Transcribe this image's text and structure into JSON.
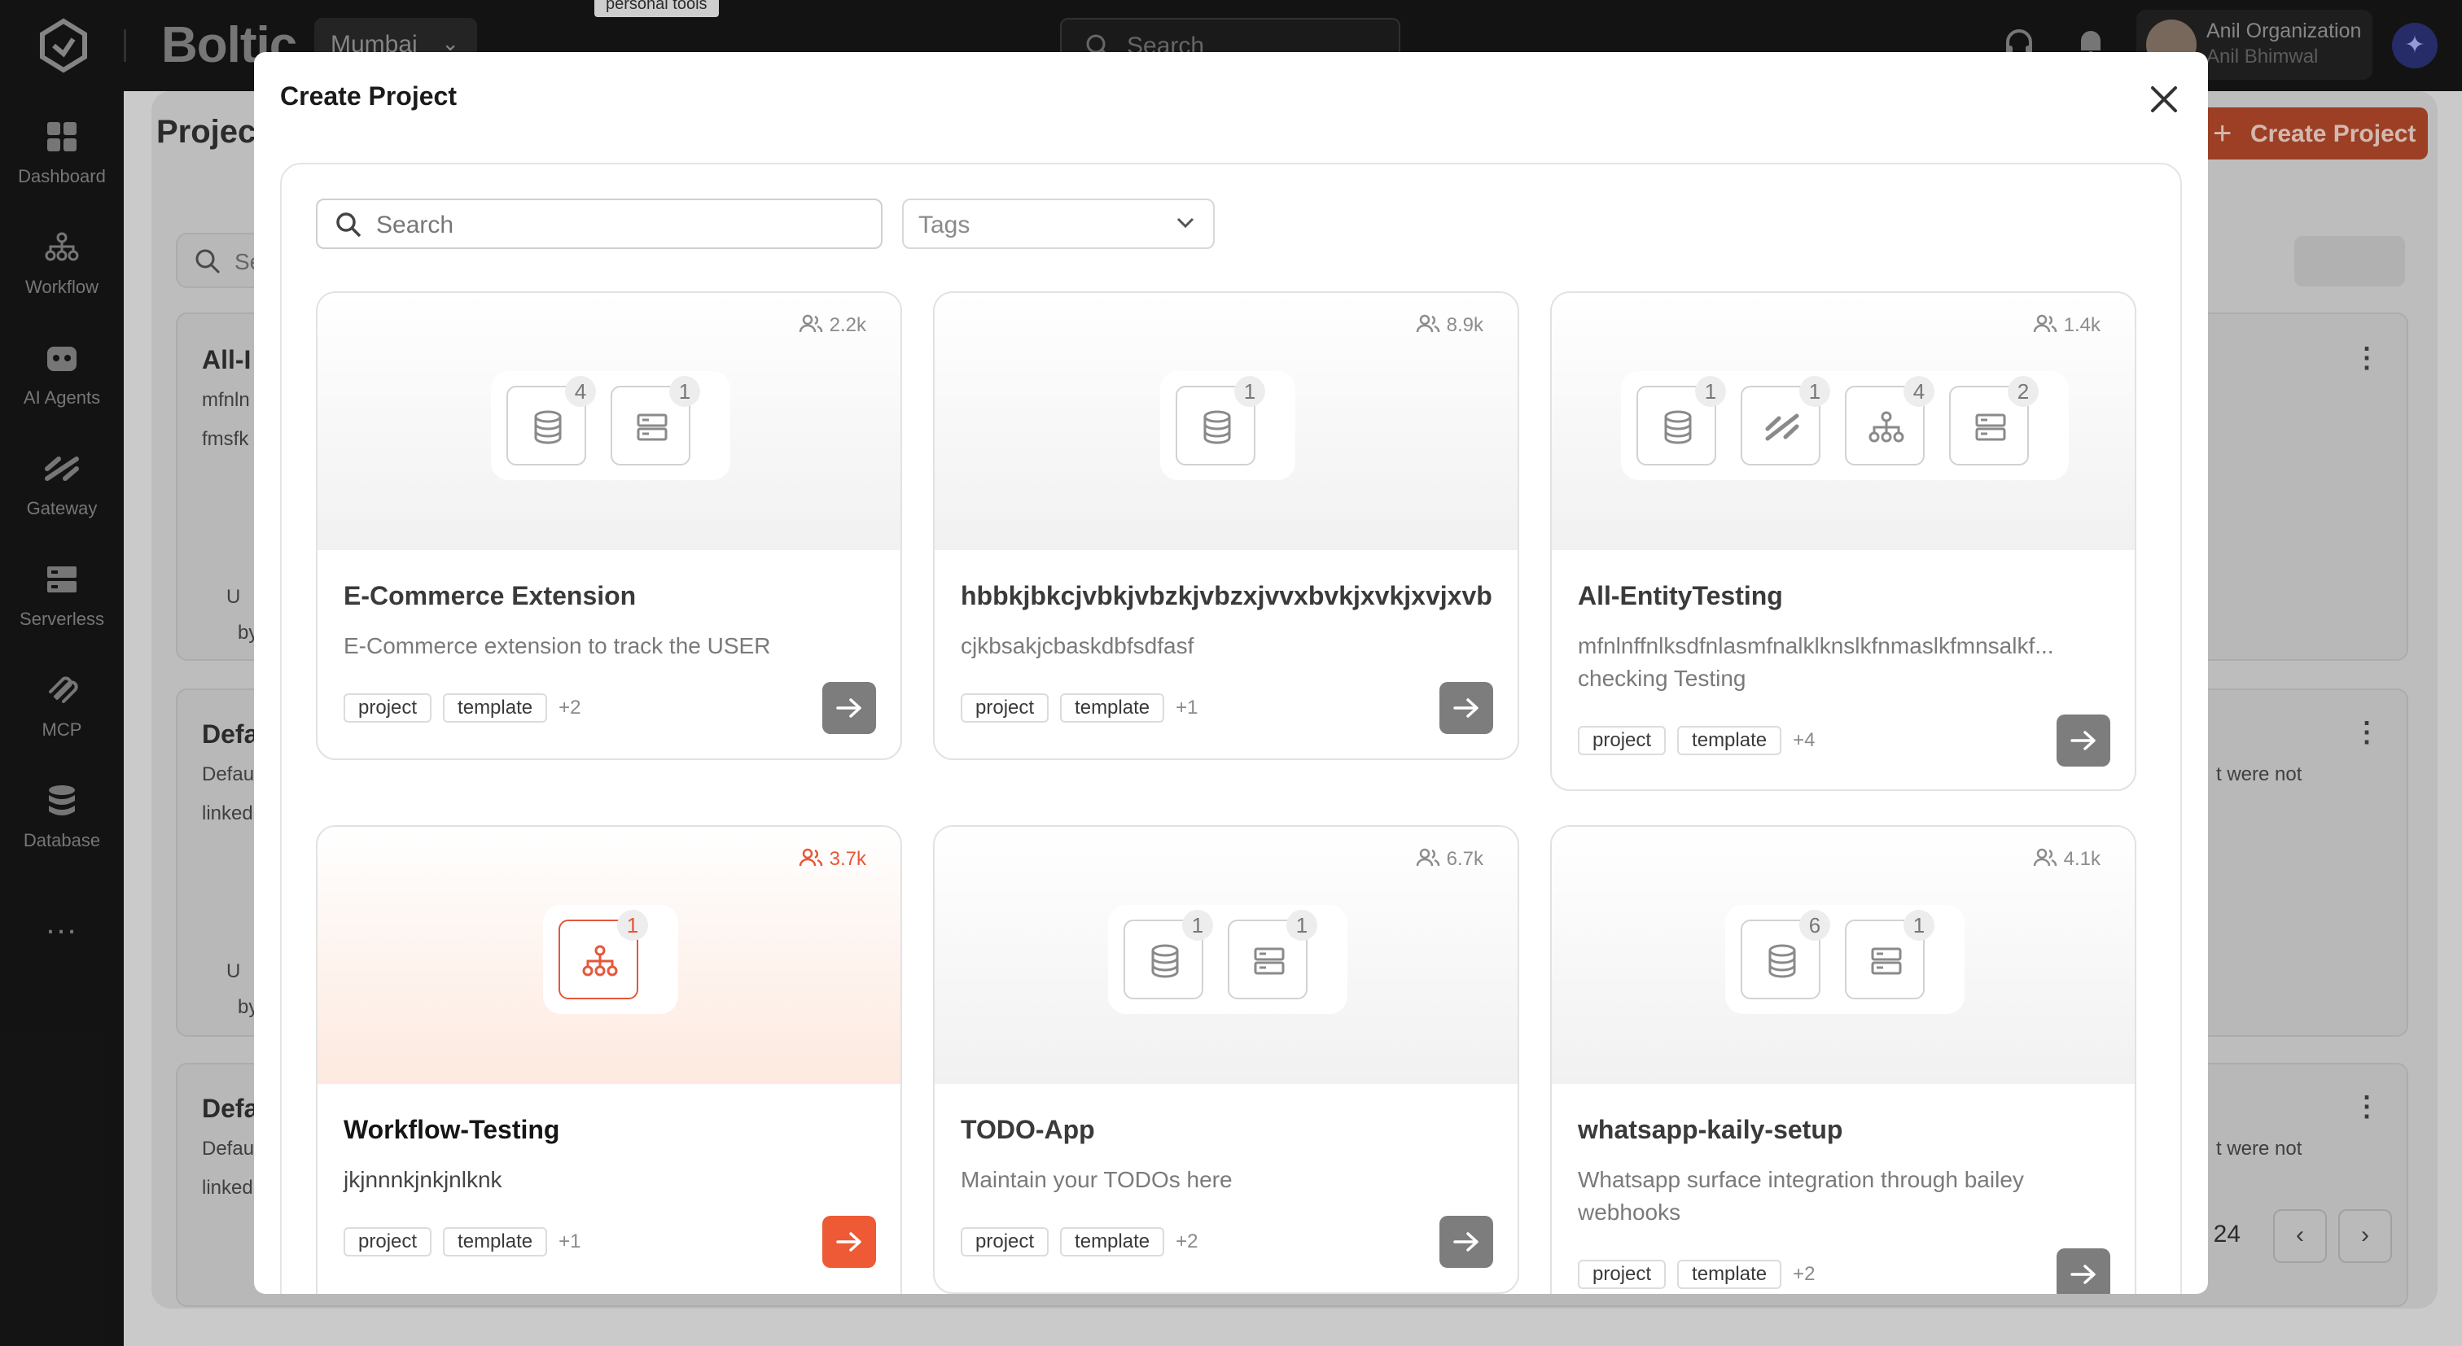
{
  "topbar": {
    "brand": "Boltic",
    "region": "Mumbai",
    "tooltip": "personal tools",
    "search_placeholder": "Search",
    "org_name": "Anil Organization",
    "user_name": "Anil Bhimwal"
  },
  "sidebar": {
    "items": [
      {
        "label": "Dashboard",
        "icon": "grid-icon"
      },
      {
        "label": "Workflow",
        "icon": "workflow-icon"
      },
      {
        "label": "AI Agents",
        "icon": "robot-icon"
      },
      {
        "label": "Gateway",
        "icon": "gateway-icon"
      },
      {
        "label": "Serverless",
        "icon": "server-icon"
      },
      {
        "label": "MCP",
        "icon": "mcp-icon"
      },
      {
        "label": "Database",
        "icon": "database-icon"
      }
    ],
    "more": "..."
  },
  "background": {
    "page_title": "Projec",
    "create_button": "Create Project",
    "search_placeholder": "Se",
    "cards": [
      {
        "title": "All-I",
        "line1": "mfnln",
        "line2": "fmsfk",
        "meta1": "U",
        "meta2": "by"
      },
      {
        "title": "Defa",
        "line1": "Defau",
        "line2": "linked",
        "meta1": "U",
        "meta2": "by",
        "right_text": "t were not"
      },
      {
        "title": "Defa",
        "line1": "Defau",
        "line2": "linked",
        "right_text": "t were not"
      }
    ],
    "pagination_text": "f 24"
  },
  "modal": {
    "title": "Create Project",
    "search_placeholder": "Search",
    "tags_placeholder": "Tags",
    "templates": [
      {
        "title": "E-Commerce Extension",
        "description": "E-Commerce extension to track the USER",
        "users": "2.2k",
        "resources": [
          {
            "type": "database-icon",
            "count": "4"
          },
          {
            "type": "server-icon",
            "count": "1"
          }
        ],
        "tags": [
          "project",
          "template"
        ],
        "more_tags": "+2",
        "active": false
      },
      {
        "title": "hbbkjbkcjvbkjvbzkjvbzxjvvxbvkjxvkjxvjxvb",
        "description": "cjkbsakjcbaskdbfsdfasf",
        "users": "8.9k",
        "resources": [
          {
            "type": "database-icon",
            "count": "1"
          }
        ],
        "tags": [
          "project",
          "template"
        ],
        "more_tags": "+1",
        "active": false
      },
      {
        "title": "All-EntityTesting",
        "description": "mfnlnffnlksdfnlasmfnalklknslkfnmaslkfmnsalkf... checking Testing",
        "users": "1.4k",
        "resources": [
          {
            "type": "database-icon",
            "count": "1"
          },
          {
            "type": "gateway-icon",
            "count": "1"
          },
          {
            "type": "workflow-icon",
            "count": "4"
          },
          {
            "type": "server-icon",
            "count": "2"
          }
        ],
        "tags": [
          "project",
          "template"
        ],
        "more_tags": "+4",
        "active": false
      },
      {
        "title": "Workflow-Testing",
        "description": "jkjnnnkjnkjnlknk",
        "users": "3.7k",
        "resources": [
          {
            "type": "workflow-icon",
            "count": "1"
          }
        ],
        "tags": [
          "project",
          "template"
        ],
        "more_tags": "+1",
        "active": true
      },
      {
        "title": "TODO-App",
        "description": "Maintain your TODOs here",
        "users": "6.7k",
        "resources": [
          {
            "type": "database-icon",
            "count": "1"
          },
          {
            "type": "server-icon",
            "count": "1"
          }
        ],
        "tags": [
          "project",
          "template"
        ],
        "more_tags": "+2",
        "active": false
      },
      {
        "title": "whatsapp-kaily-setup",
        "description": "Whatsapp surface integration through bailey webhooks",
        "users": "4.1k",
        "resources": [
          {
            "type": "database-icon",
            "count": "6"
          },
          {
            "type": "server-icon",
            "count": "1"
          }
        ],
        "tags": [
          "project",
          "template"
        ],
        "more_tags": "+2",
        "active": false
      }
    ]
  },
  "colors": {
    "accent": "#ee5a35",
    "topbar_bg": "#171717",
    "muted_button": "#7d7d7d"
  }
}
